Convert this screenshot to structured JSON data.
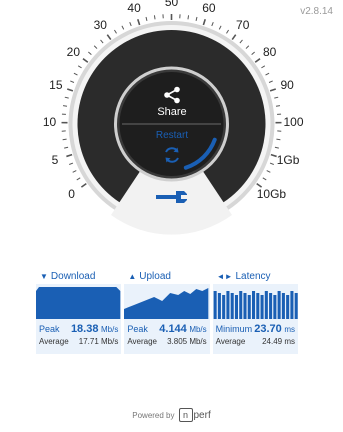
{
  "app": {
    "version": "v2.8.14"
  },
  "gauge": {
    "scale": [
      "0",
      "5",
      "10",
      "15",
      "20",
      "30",
      "40",
      "50",
      "60",
      "70",
      "80",
      "90",
      "100",
      "1Gb",
      "10Gb"
    ],
    "share_label": "Share",
    "restart_label": "Restart",
    "progress_fraction": 0.12
  },
  "metrics": {
    "download": {
      "title": "Download",
      "peak_label": "Peak",
      "peak_value": "18.38",
      "peak_unit": "Mb/s",
      "avg_label": "Average",
      "avg_value": "17.71 Mb/s"
    },
    "upload": {
      "title": "Upload",
      "peak_label": "Peak",
      "peak_value": "4.144",
      "peak_unit": "Mb/s",
      "avg_label": "Average",
      "avg_value": "3.805 Mb/s"
    },
    "latency": {
      "title": "Latency",
      "peak_label": "Minimum",
      "peak_value": "23.70",
      "peak_unit": "ms",
      "avg_label": "Average",
      "avg_value": "24.49 ms"
    }
  },
  "footer": {
    "powered_by": "Powered by",
    "brand": "perf",
    "brand_mark": "n"
  },
  "colors": {
    "accent": "#1a5fb4",
    "dark": "#2a2a2a",
    "panel": "#eaf2fb"
  }
}
